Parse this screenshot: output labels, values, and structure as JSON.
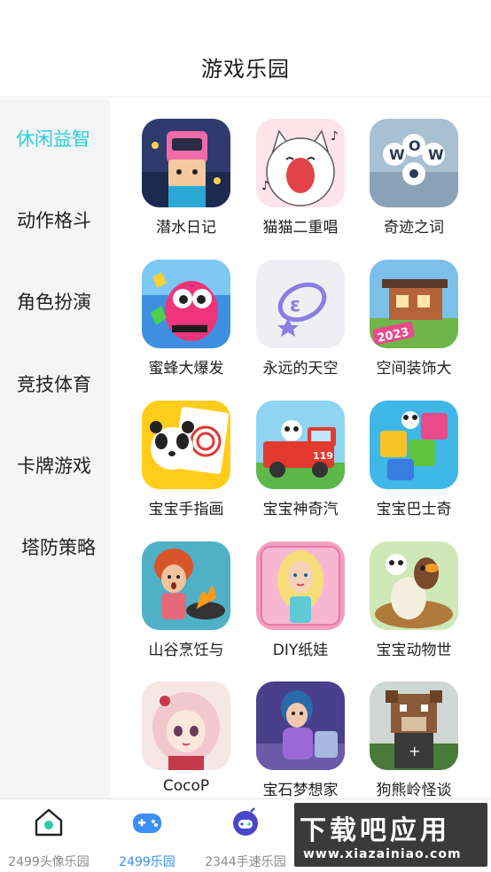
{
  "header": {
    "title": "游戏乐园"
  },
  "sidebar": {
    "categories": [
      {
        "label": "休闲益智"
      },
      {
        "label": "动作格斗"
      },
      {
        "label": "角色扮演"
      },
      {
        "label": "竞技体育"
      },
      {
        "label": "卡牌游戏"
      },
      {
        "label": "塔防策略"
      }
    ]
  },
  "games": [
    {
      "name": "潜水日记"
    },
    {
      "name": "猫猫二重唱"
    },
    {
      "name": "奇迹之词"
    },
    {
      "name": "蜜蜂大爆发"
    },
    {
      "name": "永远的天空"
    },
    {
      "name": "空间装饰大"
    },
    {
      "name": "宝宝手指画"
    },
    {
      "name": "宝宝神奇汽"
    },
    {
      "name": "宝宝巴士奇"
    },
    {
      "name": "山谷烹饪与"
    },
    {
      "name": "DIY纸娃"
    },
    {
      "name": "宝宝动物世"
    },
    {
      "name": "CocoP"
    },
    {
      "name": "宝石梦想家"
    },
    {
      "name": "狗熊岭怪谈"
    }
  ],
  "tabbar": {
    "tabs": [
      {
        "label": "2499头像乐园"
      },
      {
        "label": "2499乐园"
      },
      {
        "label": "2344手速乐园"
      }
    ]
  },
  "watermark": {
    "main": "下载吧应用",
    "url": "www.xiazainiao.com"
  },
  "colors": {
    "accent": "#28cfe0",
    "tab_active": "#3b8ff5",
    "sidebar_bg": "#f5f5f5"
  }
}
